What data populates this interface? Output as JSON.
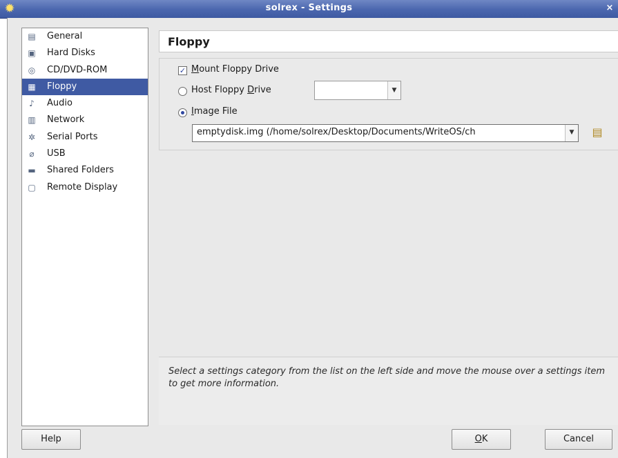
{
  "window": {
    "title": "solrex - Settings",
    "close_glyph": "×"
  },
  "sidebar": {
    "items": [
      {
        "label": "General",
        "icon": "monitor-icon"
      },
      {
        "label": "Hard Disks",
        "icon": "hard-disk-icon"
      },
      {
        "label": "CD/DVD-ROM",
        "icon": "cd-icon"
      },
      {
        "label": "Floppy",
        "icon": "floppy-icon",
        "selected": true
      },
      {
        "label": "Audio",
        "icon": "speaker-icon"
      },
      {
        "label": "Network",
        "icon": "network-icon"
      },
      {
        "label": "Serial Ports",
        "icon": "serial-port-icon"
      },
      {
        "label": "USB",
        "icon": "usb-icon"
      },
      {
        "label": "Shared Folders",
        "icon": "folder-icon"
      },
      {
        "label": "Remote Display",
        "icon": "remote-display-icon"
      }
    ]
  },
  "page": {
    "title": "Floppy"
  },
  "floppy": {
    "mount_label_mnemonic": "M",
    "mount_label_rest": "ount Floppy Drive",
    "mount_checked": true,
    "host_label_prefix": "Host Floppy ",
    "host_label_mnemonic": "D",
    "host_label_rest": "rive",
    "host_selected": false,
    "host_drive_value": "",
    "image_label_mnemonic": "I",
    "image_label_rest": "mage File",
    "image_selected": true,
    "image_path": "emptydisk.img (/home/solrex/Desktop/Documents/WriteOS/ch"
  },
  "info": {
    "text": "Select a settings category from the list on the left side and move the mouse over a settings item to get more information."
  },
  "buttons": {
    "help": "Help",
    "ok_mnemonic": "O",
    "ok_rest": "K",
    "cancel": "Cancel"
  },
  "colors": {
    "titlebar": "#4a66ae",
    "selection": "#3f5aa3",
    "dialog_bg": "#e9e9e9"
  }
}
